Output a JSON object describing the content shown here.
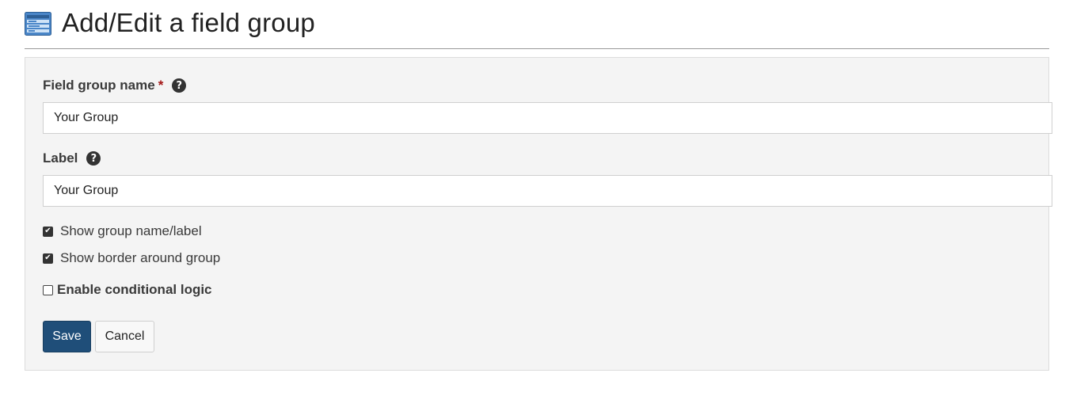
{
  "header": {
    "title": "Add/Edit a field group",
    "icon": "field-group-window-icon"
  },
  "form": {
    "field_group_name": {
      "label": "Field group name",
      "required_marker": "*",
      "help_icon": "question-circle-icon",
      "help_glyph": "?",
      "value": "Your Group"
    },
    "label_field": {
      "label": "Label",
      "help_icon": "question-circle-icon",
      "help_glyph": "?",
      "value": "Your Group"
    },
    "checkboxes": [
      {
        "label": "Show group name/label",
        "checked": true
      },
      {
        "label": "Show border around group",
        "checked": true
      },
      {
        "label": "Enable conditional logic",
        "checked": false
      }
    ],
    "buttons": {
      "save_label": "Save",
      "cancel_label": "Cancel"
    }
  },
  "colors": {
    "save_button": "#1f4e79",
    "required_star": "#a31515",
    "panel_background": "#f4f4f4"
  }
}
